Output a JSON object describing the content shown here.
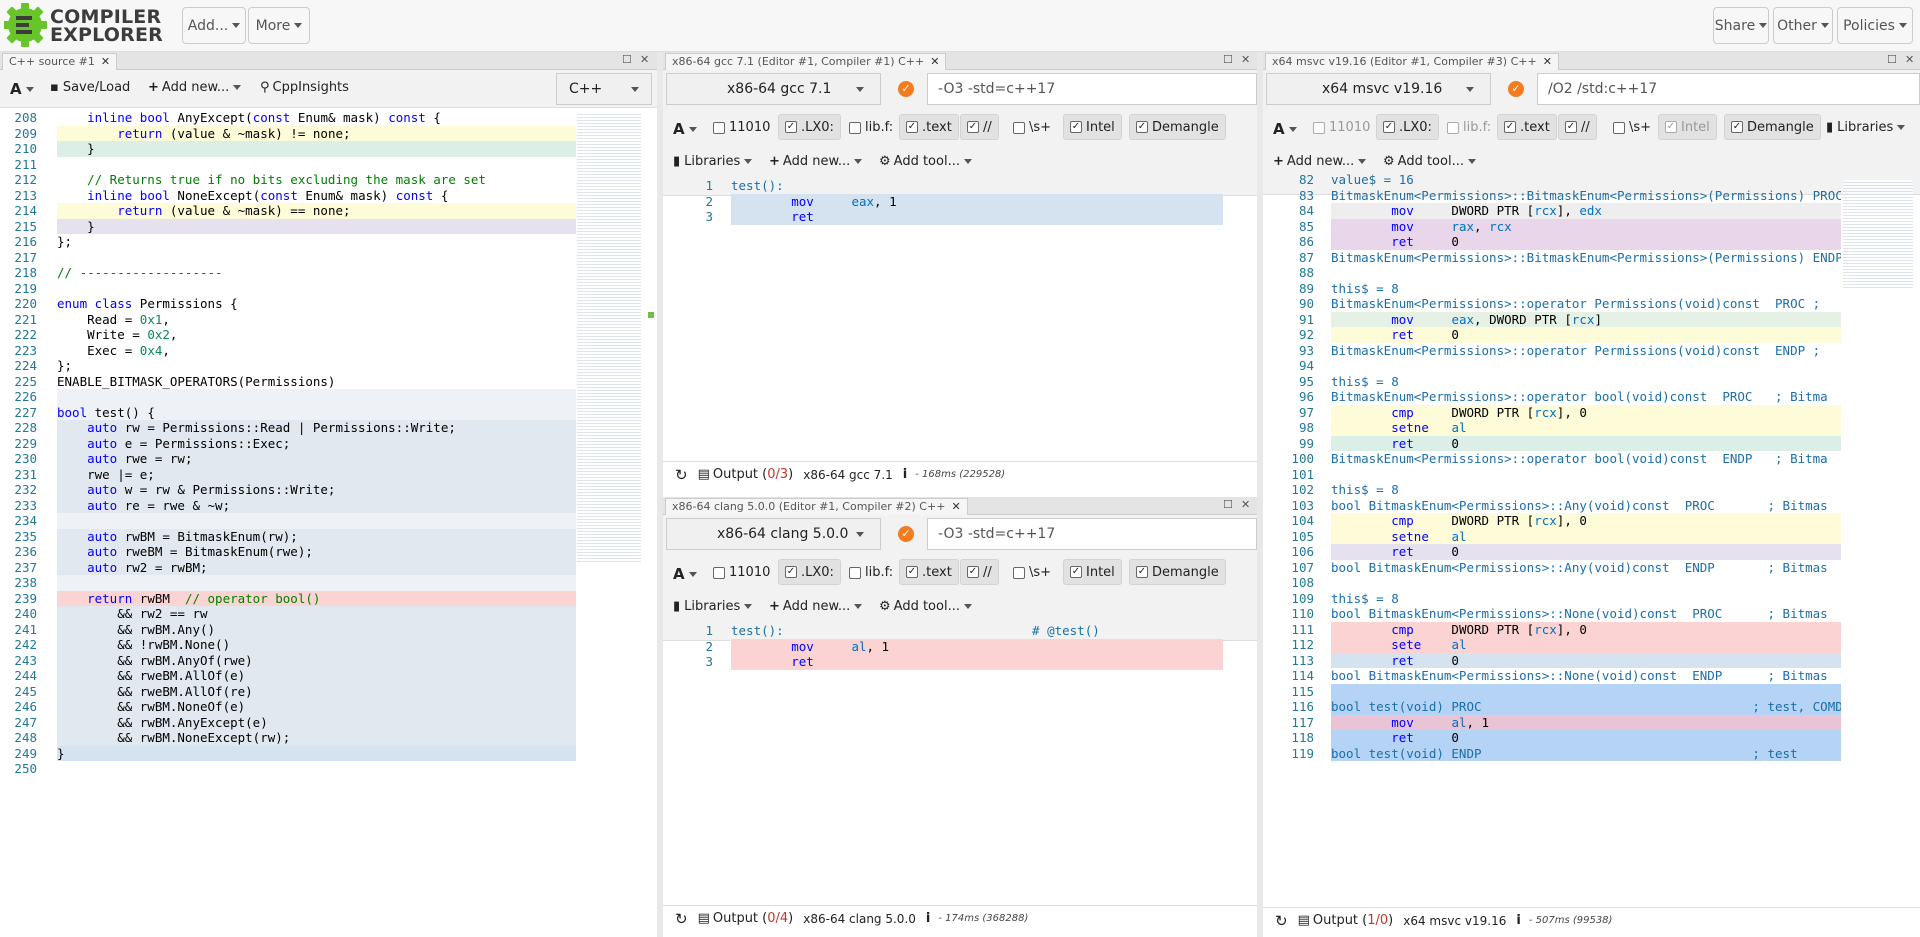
{
  "navbar": {
    "logo_top": "COMPILER",
    "logo_bottom": "EXPLORER",
    "add_label": "Add...",
    "more_label": "More",
    "share_label": "Share",
    "other_label": "Other",
    "policies_label": "Policies"
  },
  "source": {
    "tab_title": "C++ source #1",
    "save_load": "Save/Load",
    "add_new": "Add new...",
    "cppinsights": "CppInsights",
    "language": "C++",
    "lines": [
      {
        "n": "208",
        "t": "    inline bool AnyExcept(const Enum& mask) const {",
        "bg": ""
      },
      {
        "n": "209",
        "t": "        return (value & ~mask) != none;",
        "bg": "#fdfbd8"
      },
      {
        "n": "210",
        "t": "    }",
        "bg": "#dcefe6"
      },
      {
        "n": "211",
        "t": "",
        "bg": ""
      },
      {
        "n": "212",
        "t": "    // Returns true if no bits excluding the mask are set",
        "bg": ""
      },
      {
        "n": "213",
        "t": "    inline bool NoneExcept(const Enum& mask) const {",
        "bg": ""
      },
      {
        "n": "214",
        "t": "        return (value & ~mask) == none;",
        "bg": "#fdfbd8"
      },
      {
        "n": "215",
        "t": "    }",
        "bg": "#e6e1ef"
      },
      {
        "n": "216",
        "t": "};",
        "bg": ""
      },
      {
        "n": "217",
        "t": "",
        "bg": ""
      },
      {
        "n": "218",
        "t": "// -------------------",
        "bg": ""
      },
      {
        "n": "219",
        "t": "",
        "bg": ""
      },
      {
        "n": "220",
        "t": "enum class Permissions {",
        "bg": ""
      },
      {
        "n": "221",
        "t": "    Read = 0x1,",
        "bg": ""
      },
      {
        "n": "222",
        "t": "    Write = 0x2,",
        "bg": ""
      },
      {
        "n": "223",
        "t": "    Exec = 0x4,",
        "bg": ""
      },
      {
        "n": "224",
        "t": "};",
        "bg": ""
      },
      {
        "n": "225",
        "t": "ENABLE_BITMASK_OPERATORS(Permissions)",
        "bg": ""
      },
      {
        "n": "226",
        "t": "",
        "bg": "#eef2f7"
      },
      {
        "n": "227",
        "t": "bool test() {",
        "bg": "#eef2f7"
      },
      {
        "n": "228",
        "t": "    auto rw = Permissions::Read | Permissions::Write;",
        "bg": "#e2e8f0"
      },
      {
        "n": "229",
        "t": "    auto e = Permissions::Exec;",
        "bg": "#e2e8f0"
      },
      {
        "n": "230",
        "t": "    auto rwe = rw;",
        "bg": "#e2e8f0"
      },
      {
        "n": "231",
        "t": "    rwe |= e;",
        "bg": "#e2e8f0"
      },
      {
        "n": "232",
        "t": "    auto w = rw & Permissions::Write;",
        "bg": "#e2e8f0"
      },
      {
        "n": "233",
        "t": "    auto re = rwe & ~w;",
        "bg": "#e2e8f0"
      },
      {
        "n": "234",
        "t": "",
        "bg": "#eef2f7"
      },
      {
        "n": "235",
        "t": "    auto rwBM = BitmaskEnum(rw);",
        "bg": "#e2e8f0"
      },
      {
        "n": "236",
        "t": "    auto rweBM = BitmaskEnum(rwe);",
        "bg": "#e2e8f0"
      },
      {
        "n": "237",
        "t": "    auto rw2 = rwBM;",
        "bg": "#e2e8f0"
      },
      {
        "n": "238",
        "t": "",
        "bg": "#eef2f7"
      },
      {
        "n": "239",
        "t": "    return rwBM  // operator bool()",
        "bg": "#fbd3d3"
      },
      {
        "n": "240",
        "t": "        && rw2 == rw",
        "bg": "#e2e8f0"
      },
      {
        "n": "241",
        "t": "        && rwBM.Any()",
        "bg": "#e2e8f0"
      },
      {
        "n": "242",
        "t": "        && !rwBM.None()",
        "bg": "#e2e8f0"
      },
      {
        "n": "243",
        "t": "        && rwBM.AnyOf(rwe)",
        "bg": "#e2e8f0"
      },
      {
        "n": "244",
        "t": "        && rweBM.AllOf(e)",
        "bg": "#e2e8f0"
      },
      {
        "n": "245",
        "t": "        && rweBM.AllOf(re)",
        "bg": "#e2e8f0"
      },
      {
        "n": "246",
        "t": "        && rwBM.NoneOf(e)",
        "bg": "#e2e8f0"
      },
      {
        "n": "247",
        "t": "        && rwBM.AnyExcept(e)",
        "bg": "#e2e8f0"
      },
      {
        "n": "248",
        "t": "        && rwBM.NoneExcept(rw);",
        "bg": "#e2e8f0"
      },
      {
        "n": "249",
        "t": "}",
        "bg": "#d5e3f0"
      },
      {
        "n": "250",
        "t": "",
        "bg": ""
      }
    ]
  },
  "gcc": {
    "tab_title": "x86-64 gcc 7.1 (Editor #1, Compiler #1) C++",
    "compiler": "x86-64 gcc 7.1",
    "options": "-O3 -std=c++17",
    "filters": [
      "11010",
      ".LX0:",
      "lib.f:",
      ".text",
      "//",
      "\\s+",
      "Intel",
      "Demangle"
    ],
    "libraries": "Libraries",
    "add_new": "Add new...",
    "add_tool": "Add tool...",
    "lines": [
      {
        "n": "1",
        "t": "test():",
        "bg": ""
      },
      {
        "n": "2",
        "t": "        mov     eax, 1",
        "bg": "#d5e3f0"
      },
      {
        "n": "3",
        "t": "        ret",
        "bg": "#d5e3f0"
      }
    ],
    "output_label": "Output (",
    "output_count": "0/3",
    "output_close": ")",
    "compiler_name": "x86-64 gcc 7.1",
    "timing": "- 168ms (229528)"
  },
  "clang": {
    "tab_title": "x86-64 clang 5.0.0 (Editor #1, Compiler #2) C++",
    "compiler": "x86-64 clang 5.0.0",
    "options": "-O3 -std=c++17",
    "filters": [
      "11010",
      ".LX0:",
      "lib.f:",
      ".text",
      "//",
      "\\s+",
      "Intel",
      "Demangle"
    ],
    "libraries": "Libraries",
    "add_new": "Add new...",
    "add_tool": "Add tool...",
    "lines": [
      {
        "n": "1",
        "t": "test():                                 # @test()",
        "bg": ""
      },
      {
        "n": "2",
        "t": "        mov     al, 1",
        "bg": "#fbd3d3"
      },
      {
        "n": "3",
        "t": "        ret",
        "bg": "#fbd3d3"
      }
    ],
    "output_label": "Output (",
    "output_count": "0/4",
    "output_close": ")",
    "compiler_name": "x86-64 clang 5.0.0",
    "timing": "- 174ms (368288)"
  },
  "msvc": {
    "tab_title": "x64 msvc v19.16 (Editor #1, Compiler #3) C++",
    "compiler": "x64 msvc v19.16",
    "options": "/O2 /std:c++17",
    "filters": [
      "11010",
      ".LX0:",
      "lib.f:",
      ".text",
      "//",
      "\\s+",
      "Intel",
      "Demangle"
    ],
    "libraries": "Libraries",
    "add_new": "Add new...",
    "add_tool": "Add tool...",
    "lines": [
      {
        "n": "82",
        "t": "value$ = 16",
        "bg": ""
      },
      {
        "n": "83",
        "t": "BitmaskEnum<Permissions>::BitmaskEnum<Permissions>(Permissions) PROC",
        "bg": ""
      },
      {
        "n": "84",
        "t": "        mov     DWORD PTR [rcx], edx",
        "bg": "#eeeeee"
      },
      {
        "n": "85",
        "t": "        mov     rax, rcx",
        "bg": "#ead6ea"
      },
      {
        "n": "86",
        "t": "        ret     0",
        "bg": "#ead6ea"
      },
      {
        "n": "87",
        "t": "BitmaskEnum<Permissions>::BitmaskEnum<Permissions>(Permissions) ENDP",
        "bg": ""
      },
      {
        "n": "88",
        "t": "",
        "bg": ""
      },
      {
        "n": "89",
        "t": "this$ = 8",
        "bg": ""
      },
      {
        "n": "90",
        "t": "BitmaskEnum<Permissions>::operator Permissions(void)const  PROC ;",
        "bg": ""
      },
      {
        "n": "91",
        "t": "        mov     eax, DWORD PTR [rcx]",
        "bg": "#e6f1e6"
      },
      {
        "n": "92",
        "t": "        ret     0",
        "bg": "#fdfbd8"
      },
      {
        "n": "93",
        "t": "BitmaskEnum<Permissions>::operator Permissions(void)const  ENDP ;",
        "bg": ""
      },
      {
        "n": "94",
        "t": "",
        "bg": ""
      },
      {
        "n": "95",
        "t": "this$ = 8",
        "bg": ""
      },
      {
        "n": "96",
        "t": "BitmaskEnum<Permissions>::operator bool(void)const  PROC   ; Bitma",
        "bg": ""
      },
      {
        "n": "97",
        "t": "        cmp     DWORD PTR [rcx], 0",
        "bg": "#fdfbd8"
      },
      {
        "n": "98",
        "t": "        setne   al",
        "bg": "#fdfbd8"
      },
      {
        "n": "99",
        "t": "        ret     0",
        "bg": "#dcefe6"
      },
      {
        "n": "100",
        "t": "BitmaskEnum<Permissions>::operator bool(void)const  ENDP   ; Bitma",
        "bg": ""
      },
      {
        "n": "101",
        "t": "",
        "bg": ""
      },
      {
        "n": "102",
        "t": "this$ = 8",
        "bg": ""
      },
      {
        "n": "103",
        "t": "bool BitmaskEnum<Permissions>::Any(void)const  PROC       ; Bitmas",
        "bg": ""
      },
      {
        "n": "104",
        "t": "        cmp     DWORD PTR [rcx], 0",
        "bg": "#fdfbd8"
      },
      {
        "n": "105",
        "t": "        setne   al",
        "bg": "#fdfbd8"
      },
      {
        "n": "106",
        "t": "        ret     0",
        "bg": "#e6e1ef"
      },
      {
        "n": "107",
        "t": "bool BitmaskEnum<Permissions>::Any(void)const  ENDP       ; Bitmas",
        "bg": ""
      },
      {
        "n": "108",
        "t": "",
        "bg": ""
      },
      {
        "n": "109",
        "t": "this$ = 8",
        "bg": ""
      },
      {
        "n": "110",
        "t": "bool BitmaskEnum<Permissions>::None(void)const  PROC      ; Bitmas",
        "bg": ""
      },
      {
        "n": "111",
        "t": "        cmp     DWORD PTR [rcx], 0",
        "bg": "#fbd3d3"
      },
      {
        "n": "112",
        "t": "        sete    al",
        "bg": "#fbd3d3"
      },
      {
        "n": "113",
        "t": "        ret     0",
        "bg": "#d5e3f0"
      },
      {
        "n": "114",
        "t": "bool BitmaskEnum<Permissions>::None(void)const  ENDP      ; Bitmas",
        "bg": ""
      },
      {
        "n": "115",
        "t": "",
        "bg": "#b5d3f5"
      },
      {
        "n": "116",
        "t": "bool test(void) PROC                                    ; test, COMD",
        "bg": "#b5d3f5"
      },
      {
        "n": "117",
        "t": "        mov     al, 1",
        "bg": "#e9c4d4"
      },
      {
        "n": "118",
        "t": "        ret     0",
        "bg": "#b5d3f5"
      },
      {
        "n": "119",
        "t": "bool test(void) ENDP                                    ; test",
        "bg": "#b5d3f5"
      }
    ],
    "output_label": "Output (",
    "output_count": "1/0",
    "output_close": ")",
    "compiler_name": "x64 msvc v19.16",
    "timing": "- 507ms (99538)"
  }
}
